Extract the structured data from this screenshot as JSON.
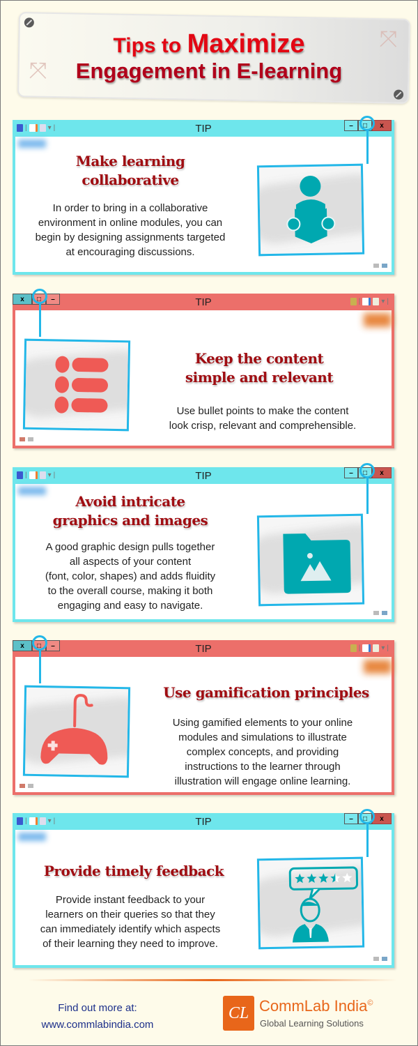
{
  "header": {
    "title_line1_prefix": "Tips to",
    "title_line1_emphasis": "Maximize",
    "title_line2": "Engagement in E-learning"
  },
  "window_controls": {
    "minimize": "–",
    "maximize": "□",
    "close": "x"
  },
  "tips": [
    {
      "window_title": "TIP",
      "theme": "cyan",
      "heading": "Make learning collaborative",
      "heading_line1": "Make learning",
      "heading_line2": "collaborative",
      "description_lines": [
        "In order to bring in a collaborative",
        "environment in online modules, you can",
        "begin by designing assignments targeted",
        "at encouraging discussions."
      ],
      "icon": "person-reading-icon"
    },
    {
      "window_title": "TIP",
      "theme": "red",
      "heading_line1": "Keep the content",
      "heading_line2": "simple and relevant",
      "description_lines": [
        "Use bullet points to make the content",
        "look crisp, relevant and comprehensible."
      ],
      "icon": "bullet-list-icon"
    },
    {
      "window_title": "TIP",
      "theme": "cyan",
      "heading_line1": "Avoid intricate",
      "heading_line2": "graphics and images",
      "description_lines": [
        "A good graphic design pulls together",
        "all aspects of your content",
        "(font, color, shapes) and adds fluidity",
        "to the overall course, making it both",
        "engaging and easy to navigate."
      ],
      "icon": "image-folder-icon"
    },
    {
      "window_title": "TIP",
      "theme": "red",
      "heading_line1": "Use gamification principles",
      "heading_line2": "",
      "description_lines": [
        "Using gamified elements to your online",
        "modules and simulations to illustrate",
        "complex concepts, and providing",
        "instructions to the learner through",
        "illustration will engage online learning."
      ],
      "icon": "gamepad-icon"
    },
    {
      "window_title": "TIP",
      "theme": "cyan",
      "heading_line1": "Provide timely feedback",
      "heading_line2": "",
      "description_lines": [
        "Provide instant feedback to your",
        "learners on their queries so that they",
        "can immediately identify which aspects",
        "of their learning they need to improve."
      ],
      "icon": "user-feedback-rating-icon",
      "rating": {
        "value": 3.5,
        "max": 5
      }
    }
  ],
  "footer": {
    "find_out_label": "Find out more at:",
    "url": "www.commlabindia.com",
    "logo_text": "CL",
    "brand_name": "CommLab India",
    "brand_mark": "©",
    "tagline": "Global Learning Solutions"
  },
  "colors": {
    "background": "#fefbea",
    "cyan_window": "#6ee6ec",
    "red_window": "#ec6f6a",
    "teal_icon": "#00a8b0",
    "coral_icon": "#ef5a55",
    "heading": "#a00d12",
    "title_red": "#e30613",
    "connector_blue": "#23b7e8",
    "brand_orange": "#e8661a",
    "link_blue": "#1c2f8a"
  }
}
